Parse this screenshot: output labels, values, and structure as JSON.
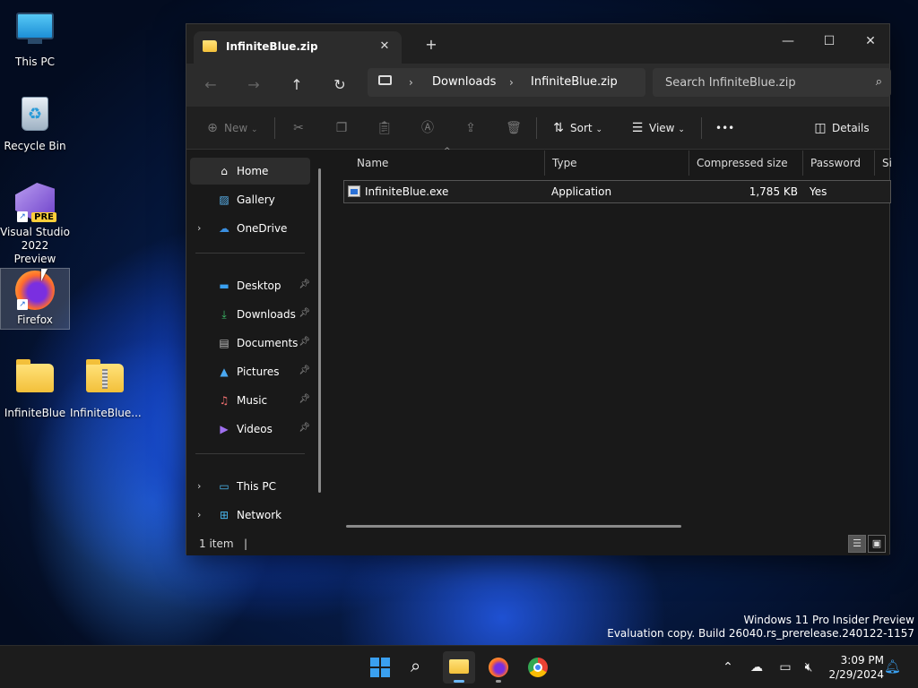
{
  "desktop": {
    "icons": [
      {
        "label": "This PC"
      },
      {
        "label": "Recycle Bin"
      },
      {
        "label": "Visual Studio 2022 Preview",
        "badge": "PRE"
      },
      {
        "label": "Firefox"
      },
      {
        "label": "InfiniteBlue"
      },
      {
        "label": "InfiniteBlue..."
      }
    ]
  },
  "window": {
    "tab_title": "InfiniteBlue.zip",
    "tab_close": "✕",
    "new_tab": "+",
    "controls": {
      "minimize": "—",
      "maximize": "☐",
      "close": "✕"
    },
    "breadcrumbs": [
      "Downloads",
      "InfiniteBlue.zip"
    ],
    "crumb_sep": "›",
    "search_placeholder": "Search InfiniteBlue.zip",
    "toolbar": {
      "new": "New",
      "sort": "Sort",
      "view": "View",
      "more": "•••",
      "details": "Details"
    },
    "sidebar": {
      "home": "Home",
      "gallery": "Gallery",
      "onedrive": "OneDrive",
      "pinned": [
        "Desktop",
        "Downloads",
        "Documents",
        "Pictures",
        "Music",
        "Videos"
      ],
      "this_pc": "This PC",
      "network": "Network"
    },
    "columns": [
      "Name",
      "Type",
      "Compressed size",
      "Password ...",
      "Si"
    ],
    "files": [
      {
        "name": "InfiniteBlue.exe",
        "type": "Application",
        "compressed_size": "1,785 KB",
        "password": "Yes"
      }
    ],
    "status": {
      "count": "1 item",
      "divider": "|"
    }
  },
  "watermark": {
    "line1": "Windows 11 Pro Insider Preview",
    "line2": "Evaluation copy. Build 26040.rs_prerelease.240122-1157"
  },
  "taskbar": {
    "time": "3:09 PM",
    "date": "2/29/2024"
  },
  "colors": {
    "accent": "#3aa0f0",
    "folder": "#f3c03a"
  }
}
